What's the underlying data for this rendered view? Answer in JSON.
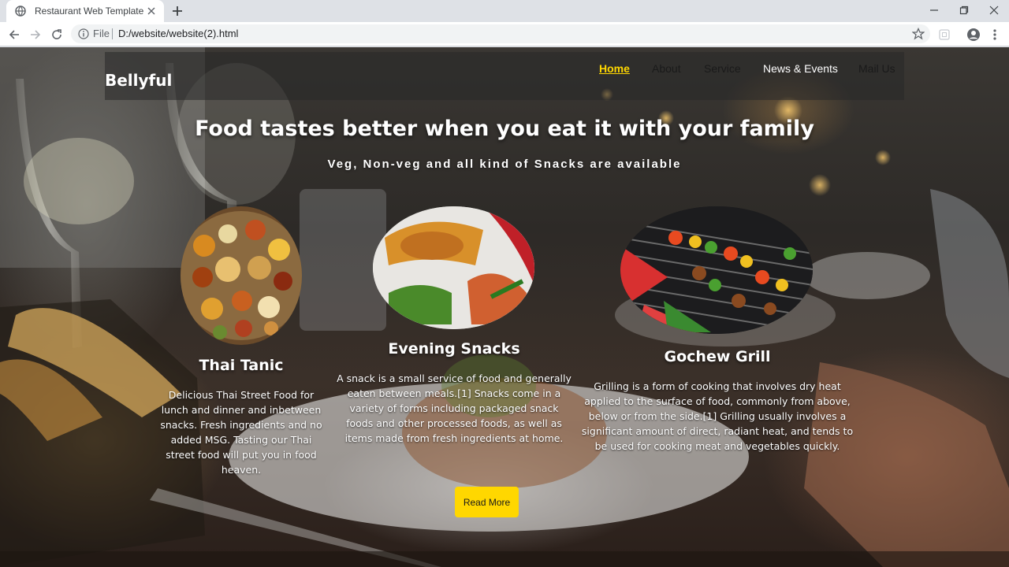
{
  "browser": {
    "tab_title": "Restaurant Web Template",
    "url_scheme": "File",
    "url_path": "D:/website/website(2).html"
  },
  "site": {
    "brand": "Bellyful",
    "nav": [
      {
        "label": "Home",
        "active": true
      },
      {
        "label": "About",
        "active": false
      },
      {
        "label": "Service",
        "active": false
      },
      {
        "label": "News & Events",
        "active": false
      },
      {
        "label": "Mail Us",
        "active": false
      }
    ],
    "hero": {
      "title": "Food tastes better when you eat it with your family",
      "subtitle": "Veg, Non-veg and all kind of Snacks are available"
    },
    "dishes": [
      {
        "title": "Thai Tanic",
        "description": "Delicious Thai Street Food for lunch and dinner and inbetween snacks. Fresh ingredients and no added MSG. Tasting our Thai street food will put you in food heaven."
      },
      {
        "title": "Evening Snacks",
        "description": "A snack is a small service of food and generally eaten between meals.[1] Snacks come in a variety of forms including packaged snack foods and other processed foods, as well as items made from fresh ingredients at home."
      },
      {
        "title": "Gochew Grill",
        "description": "Grilling is a form of cooking that involves dry heat applied to the surface of food, commonly from above, below or from the side.[1] Grilling usually involves a significant amount of direct, radiant heat, and tends to be used for cooking meat and vegetables quickly."
      }
    ],
    "cta_label": "Read More"
  },
  "colors": {
    "accent": "#ffd700",
    "header_bg": "#282828"
  }
}
